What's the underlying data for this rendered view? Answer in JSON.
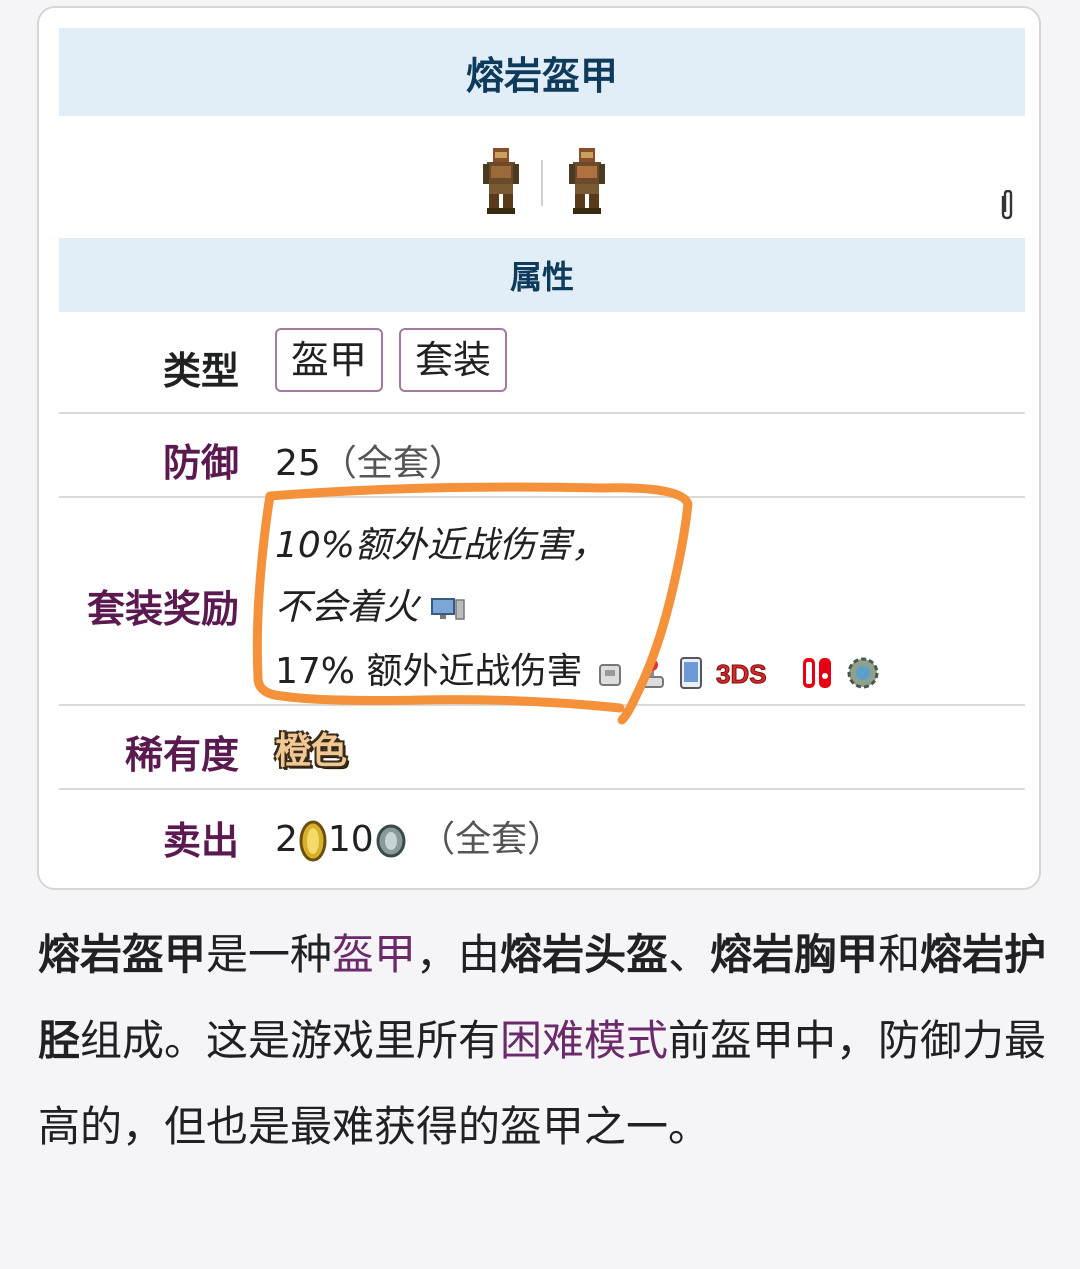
{
  "infobox": {
    "title": "熔岩盔甲",
    "section_title": "属性",
    "rows": {
      "type": {
        "label": "类型",
        "tags": [
          "盔甲",
          "套装"
        ]
      },
      "defense": {
        "label": "防御",
        "value": "25",
        "note": "（全套）"
      },
      "set_bonus": {
        "label": "套装奖励",
        "line1": "10%额外近战伤害，",
        "line2": "不会着火",
        "line3": "17% 额外近战伤害",
        "platforms": [
          "pc-icon",
          "console-icon",
          "mobile-icon",
          "3ds-icon",
          "switch-icon",
          "tmodloader-icon"
        ],
        "platform_3ds_text": "3DS"
      },
      "rarity": {
        "label": "稀有度",
        "value": "橙色",
        "color": "#f0c894"
      },
      "sell": {
        "label": "卖出",
        "gold": "2",
        "silver": "10",
        "note": "（全套）"
      }
    }
  },
  "article": {
    "t1": "熔岩盔甲",
    "t2": "是一种",
    "t3": "盔甲",
    "t4": "，由",
    "t5": "熔岩头盔",
    "t6": "、",
    "t7": "熔岩胸甲",
    "t8": "和",
    "t9": "熔岩护胫",
    "t10": "组成。这是游戏里所有",
    "t11": "困难模式",
    "t12": "前盔甲中，防御力最高的，但也是最难获得的盔甲之一。"
  },
  "colors": {
    "header_bg": "#e1eef7",
    "header_text": "#0e3a5b",
    "label_purple": "#5b1a4f",
    "link": "#6b2a6a",
    "highlight": "#f5913a"
  }
}
